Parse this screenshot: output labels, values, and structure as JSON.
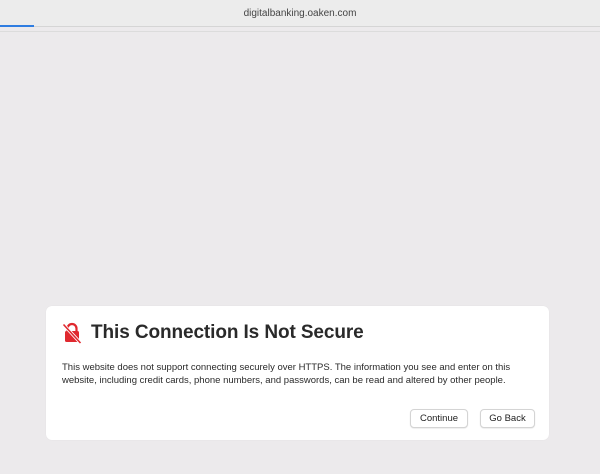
{
  "browser": {
    "url": "digitalbanking.oaken.com"
  },
  "warning": {
    "icon": "lock-crossed-icon",
    "accent_color": "#e0292f",
    "title": "This Connection Is Not Secure",
    "message": "This website does not support connecting securely over HTTPS. The information you see and enter on this website, including credit cards, phone numbers, and passwords, can be read and altered by other people."
  },
  "buttons": {
    "continue_label": "Continue",
    "go_back_label": "Go Back"
  }
}
